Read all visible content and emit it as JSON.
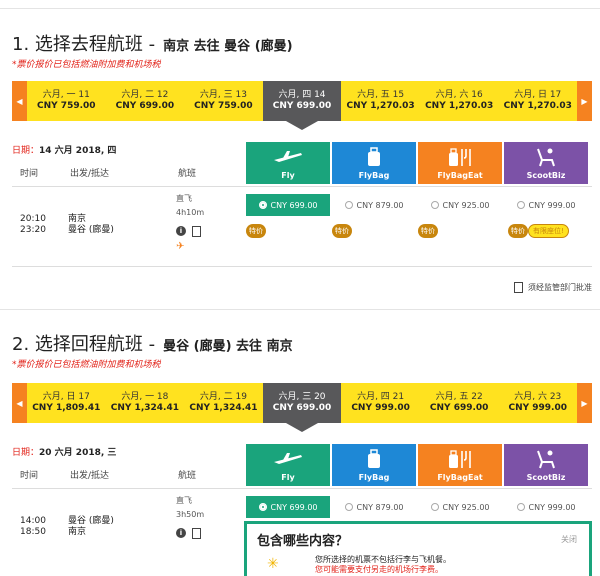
{
  "outbound": {
    "title": "1. 选择去程航班 -",
    "route": "南京 去往 曼谷 (廊曼)",
    "tax_note": "*票价报价已包括燃油附加费和机场税",
    "dates": [
      {
        "date": "六月, 一 11",
        "price": "CNY 759.00"
      },
      {
        "date": "六月, 二 12",
        "price": "CNY 699.00"
      },
      {
        "date": "六月, 三 13",
        "price": "CNY 759.00"
      },
      {
        "date": "六月, 四 14",
        "price": "CNY 699.00",
        "active": true
      },
      {
        "date": "六月, 五 15",
        "price": "CNY 1,270.03"
      },
      {
        "date": "六月, 六 16",
        "price": "CNY 1,270.03"
      },
      {
        "date": "六月, 日 17",
        "price": "CNY 1,270.03"
      }
    ],
    "date_label_key": "日期：",
    "date_label_value": "14 六月 2018, 四",
    "flight": {
      "depart_time": "20:10",
      "arrive_time": "23:20",
      "depart_city": "南京",
      "arrive_city": "曼谷 (廊曼)",
      "type": "直飞",
      "duration": "4h10m",
      "prices": [
        "CNY 699.00",
        "CNY 879.00",
        "CNY 925.00",
        "CNY 999.00"
      ],
      "badges": [
        "特价",
        "特价",
        "特价",
        "特价"
      ],
      "limited_badge": "有限座位!"
    }
  },
  "inbound": {
    "title": "2. 选择回程航班 -",
    "route": "曼谷 (廊曼) 去往 南京",
    "tax_note": "*票价报价已包括燃油附加费和机场税",
    "dates": [
      {
        "date": "六月, 日 17",
        "price": "CNY 1,809.41"
      },
      {
        "date": "六月, 一 18",
        "price": "CNY 1,324.41"
      },
      {
        "date": "六月, 二 19",
        "price": "CNY 1,324.41"
      },
      {
        "date": "六月, 三 20",
        "price": "CNY 699.00",
        "active": true
      },
      {
        "date": "六月, 四 21",
        "price": "CNY 999.00"
      },
      {
        "date": "六月, 五 22",
        "price": "CNY 699.00"
      },
      {
        "date": "六月, 六 23",
        "price": "CNY 999.00"
      }
    ],
    "date_label_key": "日期：",
    "date_label_value": "20 六月 2018, 三",
    "flight": {
      "depart_time": "14:00",
      "arrive_time": "18:50",
      "depart_city": "曼谷 (廊曼)",
      "arrive_city": "南京",
      "type": "直飞",
      "duration": "3h50m",
      "prices": [
        "CNY 699.00",
        "CNY 879.00",
        "CNY 925.00",
        "CNY 999.00"
      ]
    }
  },
  "columns": {
    "time": "时间",
    "depart_arrive": "出发/抵达",
    "flight": "航班"
  },
  "fare_tabs": [
    "Fly",
    "FlyBag",
    "FlyBagEat",
    "ScootBiz"
  ],
  "regulation_note": "须经监管部门批准",
  "popup": {
    "title": "包含哪些内容？",
    "close": "关闭",
    "line1": "您所选择的机票不包括行李与飞机餐。",
    "line2": "您可能需要支付另走的机场行李费。"
  },
  "colors": {
    "yellow": "#ffe21f",
    "orange": "#f58220",
    "fly": "#1aa47c",
    "flybag": "#1e88d6",
    "scootbiz": "#7c52a7",
    "red": "#e2231a"
  }
}
